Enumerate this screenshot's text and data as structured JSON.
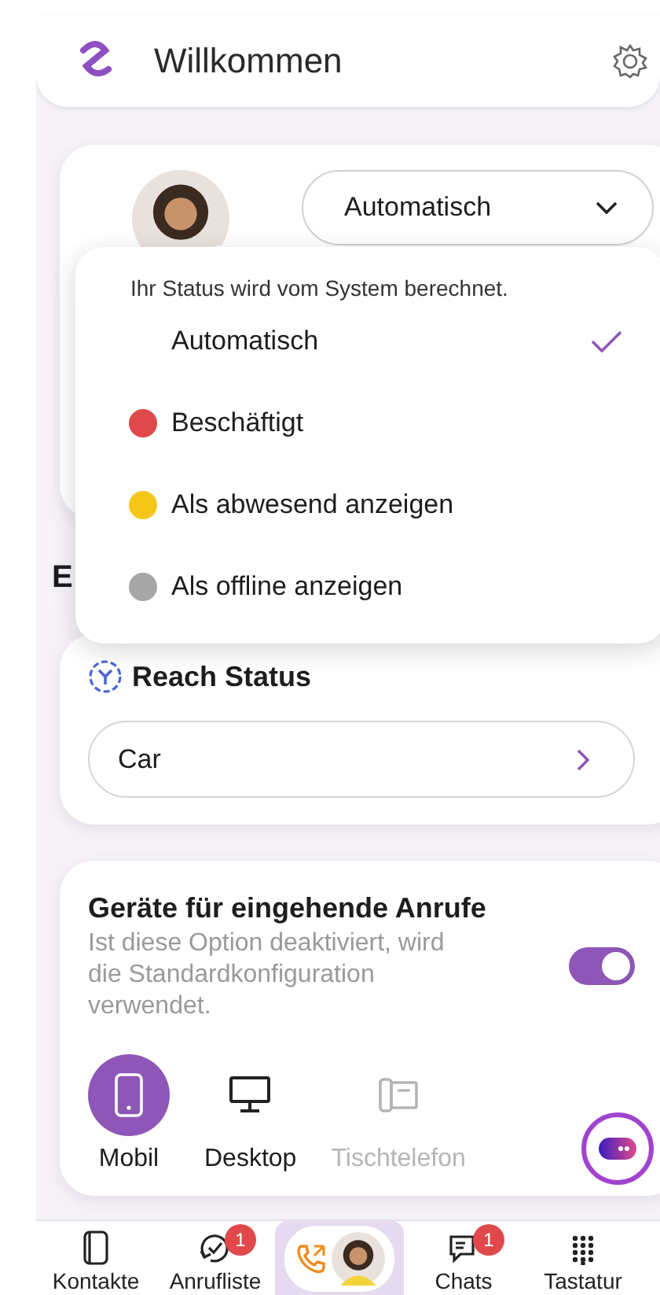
{
  "header": {
    "title": "Willkommen"
  },
  "status_card": {
    "selected_status": "Automatisch"
  },
  "section_heading": "E",
  "status_menu": {
    "hint": "Ihr Status wird vom System berechnet.",
    "options": [
      {
        "label": "Automatisch",
        "selected": true
      },
      {
        "label": "Beschäftigt",
        "selected": false,
        "color": "#e0484b"
      },
      {
        "label": "Als abwesend anzeigen",
        "selected": false,
        "color": "#f5c518"
      },
      {
        "label": "Als offline anzeigen",
        "selected": false,
        "color": "#a6a6a6"
      }
    ]
  },
  "reach_status": {
    "title": "Reach Status",
    "value": "Car"
  },
  "devices": {
    "title": "Geräte für eingehende Anrufe",
    "description": "Ist diese Option deaktiviert, wird die Standardkonfiguration verwendet.",
    "on": true,
    "options": [
      {
        "kind": "mobile",
        "label": "Mobil",
        "selected": true,
        "disabled": false
      },
      {
        "kind": "desktop",
        "label": "Desktop",
        "selected": false,
        "disabled": false
      },
      {
        "kind": "deskphone",
        "label": "Tischtelefon",
        "selected": false,
        "disabled": true
      }
    ]
  },
  "nav": [
    {
      "kind": "contacts",
      "label": "Kontakte",
      "selected": false
    },
    {
      "kind": "history",
      "label": "Anrufliste",
      "badge": "1",
      "selected": false
    },
    {
      "kind": "call",
      "selected": true
    },
    {
      "kind": "chats",
      "label": "Chats",
      "badge": "1",
      "selected": false
    },
    {
      "kind": "keypad",
      "label": "Tastatur",
      "selected": false
    }
  ]
}
